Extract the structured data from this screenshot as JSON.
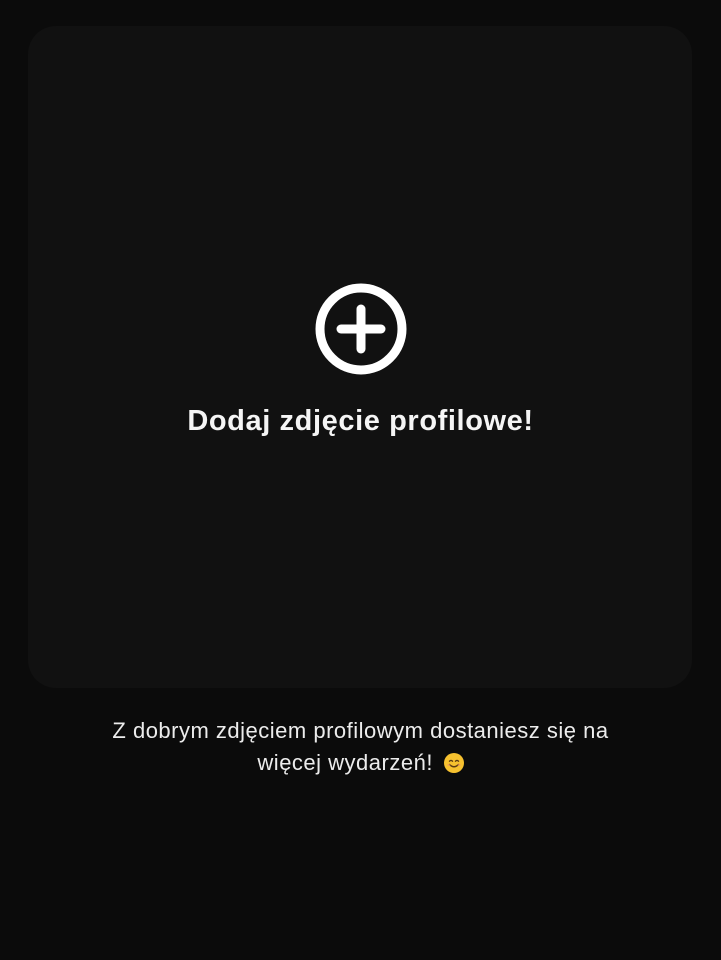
{
  "card": {
    "title": "Dodaj zdjęcie profilowe!",
    "icon": "add-circle-icon"
  },
  "hint": {
    "line1": "Z dobrym zdjęciem profilowym dostaniesz się na",
    "line2": "więcej wydarzeń!",
    "emoji": "smiling-face-icon"
  },
  "colors": {
    "background": "#0b0b0b",
    "card": "#111111",
    "text": "#ffffff",
    "emoji": "#f6c12f"
  }
}
